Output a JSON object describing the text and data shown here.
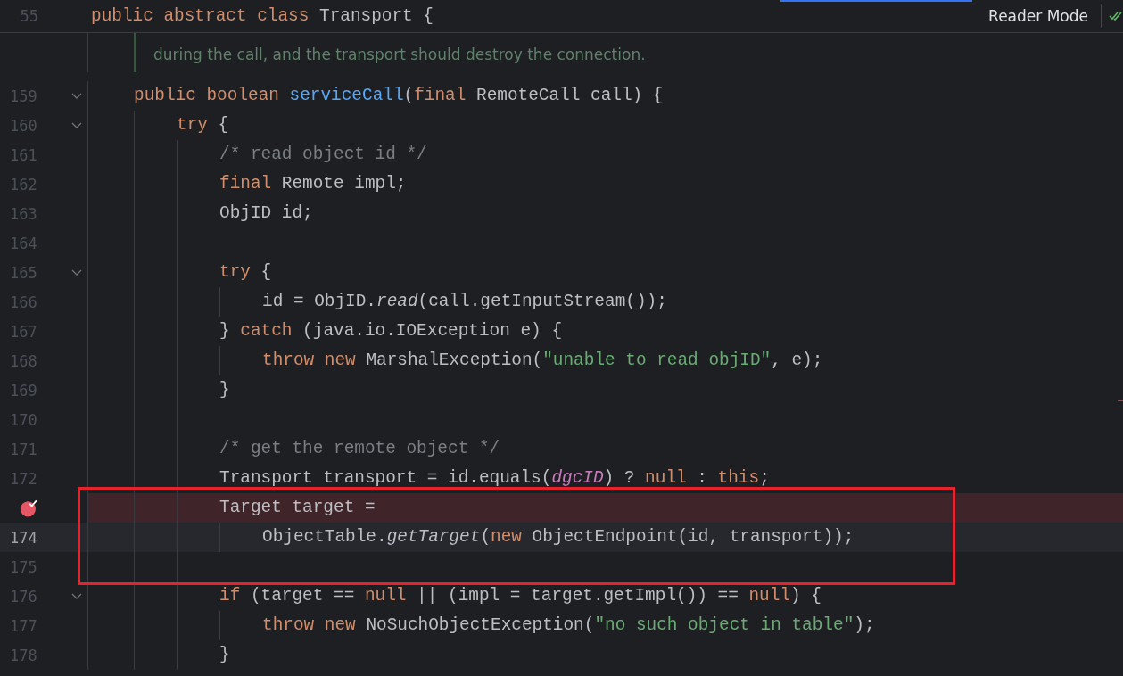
{
  "sticky_header": {
    "line_number": "55",
    "tokens": [
      {
        "text": "public abstract class ",
        "kind": "keyword"
      },
      {
        "text": "Transport {",
        "kind": "plain"
      }
    ]
  },
  "toolbar": {
    "reader_mode": "Reader Mode",
    "inspections_ok": true
  },
  "doc_comment": [
    "during the call, and the transport should destroy the connection."
  ],
  "lines": [
    {
      "number": "159",
      "fold": true,
      "breakpoint": false,
      "current": false,
      "tokens": [
        {
          "text": "public boolean ",
          "kind": "keyword"
        },
        {
          "text": "serviceCall",
          "kind": "declaration"
        },
        {
          "text": "(",
          "kind": "plain"
        },
        {
          "text": "final ",
          "kind": "keyword"
        },
        {
          "text": "RemoteCall call) {",
          "kind": "plain"
        }
      ],
      "children": [
        {
          "number": "160",
          "fold": true,
          "breakpoint": false,
          "current": false,
          "tokens": [
            {
              "text": "try ",
              "kind": "keyword"
            },
            {
              "text": "{",
              "kind": "plain"
            }
          ],
          "children": [
            {
              "number": "161",
              "fold": false,
              "breakpoint": false,
              "current": false,
              "tokens": [
                {
                  "text": "/* read object id */",
                  "kind": "comment"
                }
              ]
            },
            {
              "number": "162",
              "fold": false,
              "breakpoint": false,
              "current": false,
              "tokens": [
                {
                  "text": "final ",
                  "kind": "keyword"
                },
                {
                  "text": "Remote impl;",
                  "kind": "plain"
                }
              ]
            },
            {
              "number": "163",
              "fold": false,
              "breakpoint": false,
              "current": false,
              "tokens": [
                {
                  "text": "ObjID id;",
                  "kind": "plain"
                }
              ]
            },
            {
              "number": "164",
              "fold": false,
              "breakpoint": false,
              "current": false
            },
            {
              "number": "165",
              "fold": true,
              "breakpoint": false,
              "current": false,
              "tokens": [
                {
                  "text": "try ",
                  "kind": "keyword"
                },
                {
                  "text": "{",
                  "kind": "plain"
                }
              ],
              "children": [
                {
                  "number": "166",
                  "fold": false,
                  "breakpoint": false,
                  "current": false,
                  "tokens": [
                    {
                      "text": "id = ObjID.",
                      "kind": "plain"
                    },
                    {
                      "text": "read",
                      "kind": "static_call"
                    },
                    {
                      "text": "(call.getInputStream());",
                      "kind": "plain"
                    }
                  ]
                }
              ]
            },
            {
              "number": "167",
              "fold": false,
              "breakpoint": false,
              "current": false,
              "tokens": [
                {
                  "text": "} ",
                  "kind": "plain"
                },
                {
                  "text": "catch ",
                  "kind": "keyword"
                },
                {
                  "text": "(java.io.IOException e) {",
                  "kind": "plain"
                }
              ],
              "children": [
                {
                  "number": "168",
                  "fold": false,
                  "breakpoint": false,
                  "current": false,
                  "tokens": [
                    {
                      "text": "throw new ",
                      "kind": "keyword"
                    },
                    {
                      "text": "MarshalException(",
                      "kind": "plain"
                    },
                    {
                      "text": "\"unable to read objID\"",
                      "kind": "string"
                    },
                    {
                      "text": ", e);",
                      "kind": "plain"
                    }
                  ]
                }
              ]
            },
            {
              "number": "169",
              "fold": false,
              "breakpoint": false,
              "current": false,
              "tokens": [
                {
                  "text": "}",
                  "kind": "plain"
                }
              ]
            },
            {
              "number": "170",
              "fold": false,
              "breakpoint": false,
              "current": false
            },
            {
              "number": "171",
              "fold": false,
              "breakpoint": false,
              "current": false,
              "tokens": [
                {
                  "text": "/* get the remote object */",
                  "kind": "comment"
                }
              ]
            },
            {
              "number": "172",
              "fold": false,
              "breakpoint": false,
              "current": false,
              "tokens": [
                {
                  "text": "Transport transport = id.equals(",
                  "kind": "plain"
                },
                {
                  "text": "dgcID",
                  "kind": "static_field"
                },
                {
                  "text": ") ? ",
                  "kind": "plain"
                },
                {
                  "text": "null",
                  "kind": "keyword"
                },
                {
                  "text": " : ",
                  "kind": "plain"
                },
                {
                  "text": "this",
                  "kind": "keyword"
                },
                {
                  "text": ";",
                  "kind": "plain"
                }
              ]
            },
            {
              "fold": false,
              "breakpoint": true,
              "current": false,
              "tokens": [
                {
                  "text": "Target target =",
                  "kind": "plain"
                }
              ],
              "children": [
                {
                  "number": "174",
                  "fold": false,
                  "breakpoint": false,
                  "current": true,
                  "tokens": [
                    {
                      "text": "ObjectTable.",
                      "kind": "plain"
                    },
                    {
                      "text": "getTarget",
                      "kind": "static_call"
                    },
                    {
                      "text": "(",
                      "kind": "plain"
                    },
                    {
                      "text": "new ",
                      "kind": "keyword"
                    },
                    {
                      "text": "ObjectEndpoint(id, transport));",
                      "kind": "plain"
                    }
                  ]
                }
              ]
            },
            {
              "number": "175",
              "fold": false,
              "breakpoint": false,
              "current": false
            },
            {
              "number": "176",
              "fold": true,
              "breakpoint": false,
              "current": false,
              "tokens": [
                {
                  "text": "if ",
                  "kind": "keyword"
                },
                {
                  "text": "(target == ",
                  "kind": "plain"
                },
                {
                  "text": "null",
                  "kind": "keyword"
                },
                {
                  "text": " || (impl = target.getImpl()) == ",
                  "kind": "plain"
                },
                {
                  "text": "null",
                  "kind": "keyword"
                },
                {
                  "text": ") {",
                  "kind": "plain"
                }
              ],
              "children": [
                {
                  "number": "177",
                  "fold": false,
                  "breakpoint": false,
                  "current": false,
                  "tokens": [
                    {
                      "text": "throw new ",
                      "kind": "keyword"
                    },
                    {
                      "text": "NoSuchObjectException(",
                      "kind": "plain"
                    },
                    {
                      "text": "\"no such object in table\"",
                      "kind": "string"
                    },
                    {
                      "text": ");",
                      "kind": "plain"
                    }
                  ]
                }
              ]
            },
            {
              "number": "178",
              "fold": false,
              "breakpoint": false,
              "current": false,
              "tokens": [
                {
                  "text": "}",
                  "kind": "plain"
                }
              ]
            }
          ]
        }
      ]
    }
  ]
}
